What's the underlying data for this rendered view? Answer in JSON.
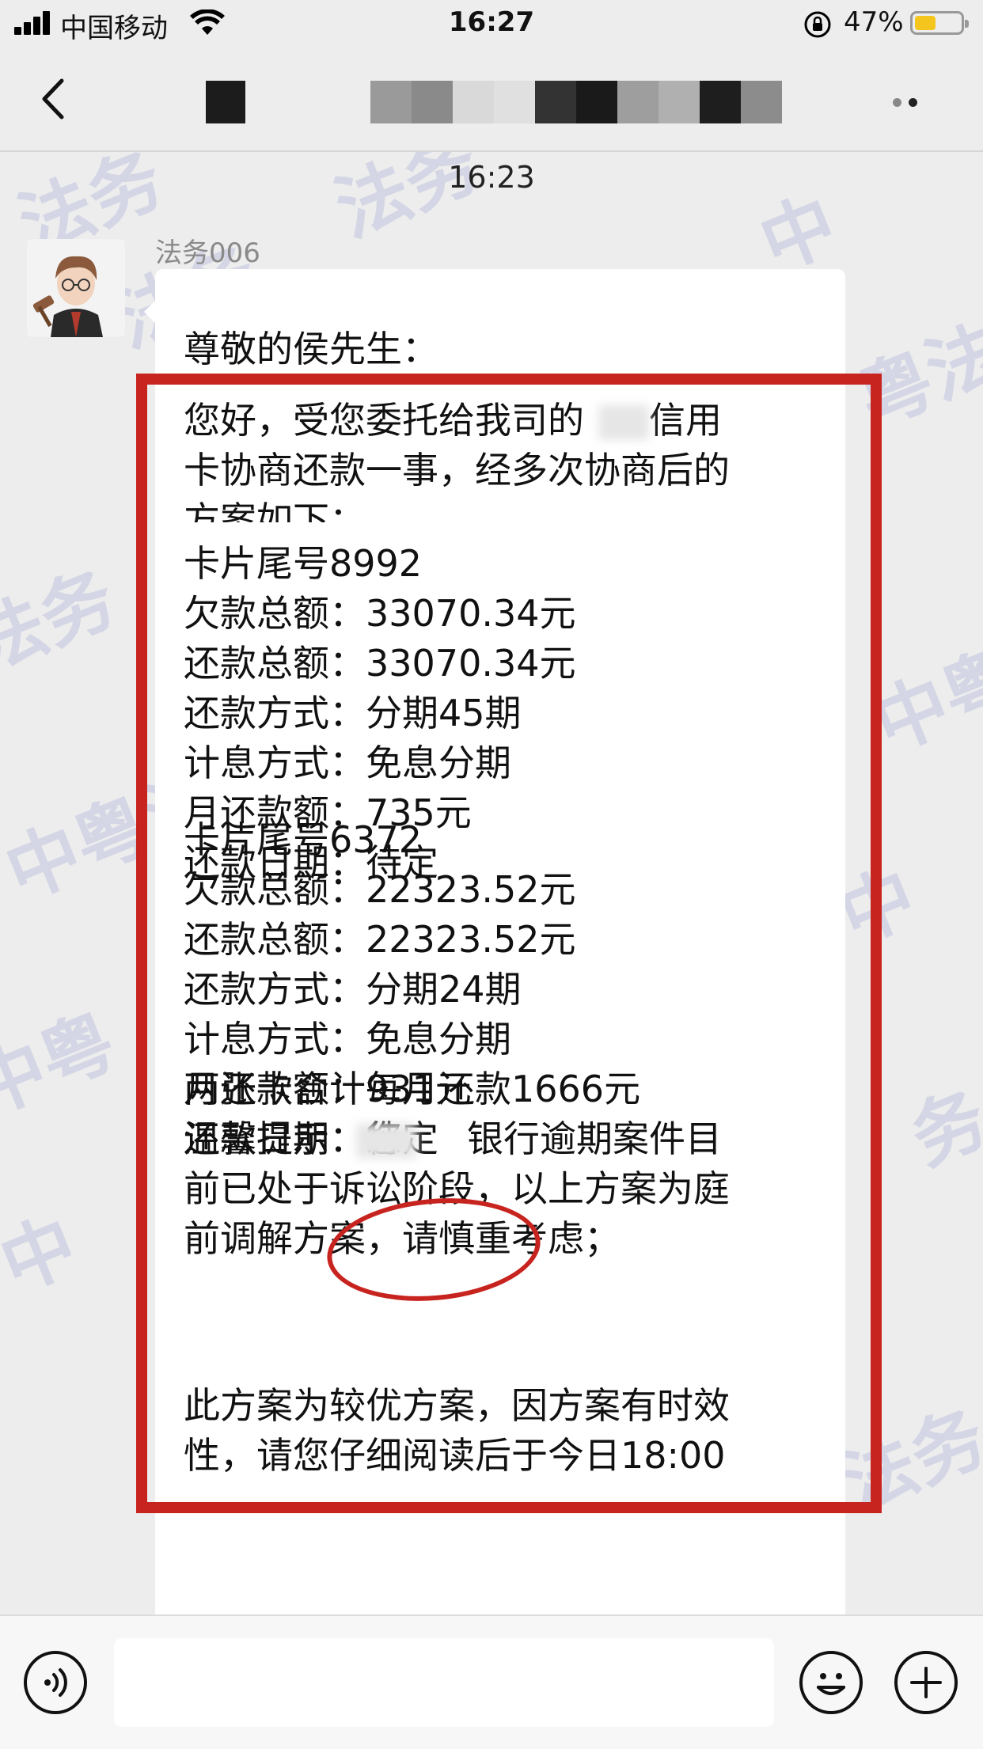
{
  "status_bar": {
    "carrier": "中国移动",
    "time": "16:27",
    "battery_percent": "47%",
    "battery_level": 0.47,
    "icons": [
      "signal-icon",
      "wifi-icon",
      "orientation-lock-icon",
      "battery-icon"
    ]
  },
  "nav": {
    "back_icon": "chevron-left-icon",
    "more_icon": "more-dots-icon"
  },
  "chat": {
    "timestamp": "16:23",
    "sender": "法务006",
    "watermark": [
      "法务",
      "法务",
      "中",
      "法务",
      "粤法",
      "法务",
      "中粤",
      "中粤法",
      "中",
      "中粤",
      "务",
      "中",
      "法务"
    ],
    "message": {
      "greeting": "尊敬的侯先生：",
      "intro_1": "您好，受您委托给我司的",
      "intro_1b": "信用",
      "intro_2": "卡协商还款一事，经多次协商后的",
      "intro_3": "方案如下：",
      "card1": [
        "卡片尾号8992",
        "欠款总额：33070.34元",
        "还款总额：33070.34元",
        "还款方式：分期45期",
        "计息方式：免息分期",
        "月还款额：735元",
        "还款日期：待定"
      ],
      "card2": [
        "卡片尾号6372",
        "欠款总额：22323.52元",
        "还款总额：22323.52元",
        "还款方式：分期24期",
        "计息方式：免息分期",
        "月还款额：931元",
        "还款日期：待定"
      ],
      "total": "两张卡合计每月还款1666元",
      "tip_1a": "温馨提示：您",
      "tip_1b": "银行逾期案件目",
      "tip_2": "前已处于诉讼阶段，以上方案为庭",
      "tip_3": "前调解方案，请慎重考虑；",
      "closing_1": "此方案为较优方案，因方案有时效",
      "closing_2": "性，请您仔细阅读后于今日18:00"
    }
  },
  "input_bar": {
    "icons": [
      "voice-icon",
      "emoji-icon",
      "plus-icon"
    ]
  },
  "colors": {
    "annotation_red": "#c8241f",
    "battery_fill": "#f4c61d",
    "background": "#ededed"
  }
}
